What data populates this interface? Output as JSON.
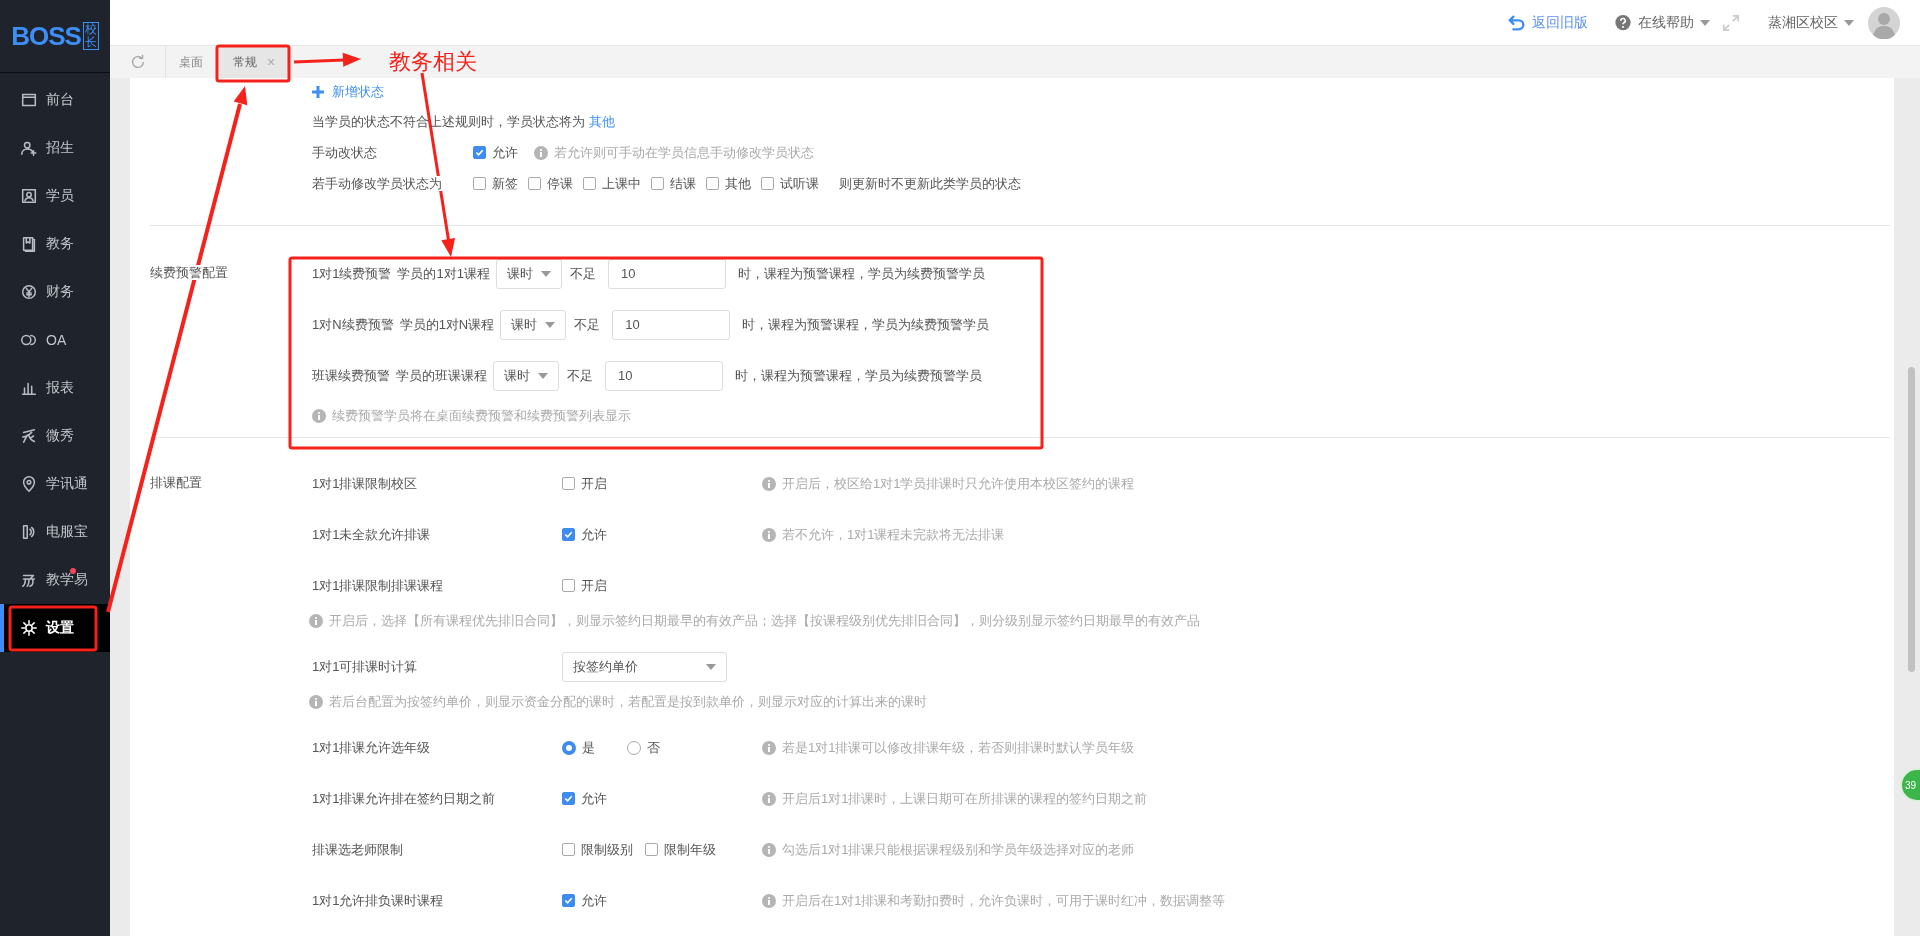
{
  "logo": {
    "text": "BOSS",
    "badge": "校长"
  },
  "sidebar": {
    "items": [
      {
        "label": "前台",
        "selected": false,
        "badge": false
      },
      {
        "label": "招生",
        "selected": false,
        "badge": false
      },
      {
        "label": "学员",
        "selected": false,
        "badge": false
      },
      {
        "label": "教务",
        "selected": false,
        "badge": false
      },
      {
        "label": "财务",
        "selected": false,
        "badge": false
      },
      {
        "label": "OA",
        "selected": false,
        "badge": false
      },
      {
        "label": "报表",
        "selected": false,
        "badge": false
      },
      {
        "label": "微秀",
        "selected": false,
        "badge": false
      },
      {
        "label": "学讯通",
        "selected": false,
        "badge": false
      },
      {
        "label": "电服宝",
        "selected": false,
        "badge": false
      },
      {
        "label": "教学易",
        "selected": false,
        "badge": true
      },
      {
        "label": "设置",
        "selected": true,
        "badge": false
      }
    ]
  },
  "topbar": {
    "back_link": "返回旧版",
    "help": "在线帮助",
    "campus": "蒸湘区校区"
  },
  "tabs": [
    {
      "label": "桌面",
      "selected": false,
      "closable": false
    },
    {
      "label": "常规",
      "selected": true,
      "closable": true,
      "close": "×"
    }
  ],
  "status_section": {
    "add_link": "新增状态",
    "fallback_text": "当学员的状态不符合上述规则时，学员状态将为",
    "fallback_value": "其他",
    "manual": {
      "label": "手动改状态",
      "option": {
        "label": "允许",
        "checked": true
      },
      "hint": "若允许则可手动在学员信息手动修改学员状态"
    },
    "exclude": {
      "label": "若手动修改学员状态为",
      "options": [
        {
          "label": "新签",
          "checked": false
        },
        {
          "label": "停课",
          "checked": false
        },
        {
          "label": "上课中",
          "checked": false
        },
        {
          "label": "结课",
          "checked": false
        },
        {
          "label": "其他",
          "checked": false
        },
        {
          "label": "试听课",
          "checked": false
        }
      ],
      "suffix": "则更新时不更新此类学员的状态"
    }
  },
  "renewal_section": {
    "title": "续费预警配置",
    "rows": [
      {
        "name": "1对1续费预警",
        "course": "学员的1对1课程",
        "unit": "课时",
        "shortfall": "不足",
        "value": "10",
        "suffix": "时，课程为预警课程，学员为续费预警学员"
      },
      {
        "name": "1对N续费预警",
        "course": "学员的1对N课程",
        "unit": "课时",
        "shortfall": "不足",
        "value": "10",
        "suffix": "时，课程为预警课程，学员为续费预警学员"
      },
      {
        "name": "班课续费预警",
        "course": "学员的班课课程",
        "unit": "课时",
        "shortfall": "不足",
        "value": "10",
        "suffix": "时，课程为预警课程，学员为续费预警学员"
      }
    ],
    "note": "续费预警学员将在桌面续费预警和续费预警列表显示"
  },
  "scheduling_section": {
    "title": "排课配置",
    "rows": [
      {
        "kind": "checkbox",
        "label": "1对1排课限制校区",
        "options": [
          {
            "label": "开启",
            "checked": false
          }
        ],
        "hint": "开启后，校区给1对1学员排课时只允许使用本校区签约的课程"
      },
      {
        "kind": "checkbox",
        "label": "1对1未全款允许排课",
        "options": [
          {
            "label": "允许",
            "checked": true
          }
        ],
        "hint": "若不允许，1对1课程未完款将无法排课"
      },
      {
        "kind": "checkbox",
        "label": "1对1排课限制排课课程",
        "options": [
          {
            "label": "开启",
            "checked": false
          }
        ],
        "note": "开启后，选择【所有课程优先排旧合同】，则显示签约日期最早的有效产品；选择【按课程级别优先排旧合同】，则分级别显示签约日期最早的有效产品"
      },
      {
        "kind": "select",
        "label": "1对1可排课时计算",
        "value": "按签约单价",
        "note": "若后台配置为按签约单价，则显示资金分配的课时，若配置是按到款单价，则显示对应的计算出来的课时"
      },
      {
        "kind": "radio",
        "label": "1对1排课允许选年级",
        "options": [
          {
            "label": "是",
            "selected": true
          },
          {
            "label": "否",
            "selected": false
          }
        ],
        "hint": "若是1对1排课可以修改排课年级，若否则排课时默认学员年级"
      },
      {
        "kind": "checkbox",
        "label": "1对1排课允许排在签约日期之前",
        "options": [
          {
            "label": "允许",
            "checked": true
          }
        ],
        "hint": "开启后1对1排课时，上课日期可在所排课的课程的签约日期之前"
      },
      {
        "kind": "checkbox",
        "label": "排课选老师限制",
        "options": [
          {
            "label": "限制级别",
            "checked": false
          },
          {
            "label": "限制年级",
            "checked": false
          }
        ],
        "hint": "勾选后1对1排课只能根据课程级别和学员年级选择对应的老师"
      },
      {
        "kind": "checkbox",
        "label": "1对1允许排负课时课程",
        "options": [
          {
            "label": "允许",
            "checked": true
          }
        ],
        "hint": "开启后在1对1排课和考勤扣费时，允许负课时，可用于课时红冲，数据调整等"
      }
    ]
  },
  "chat_badge": {
    "count": "39"
  },
  "annotation": {
    "label": "教务相关"
  }
}
